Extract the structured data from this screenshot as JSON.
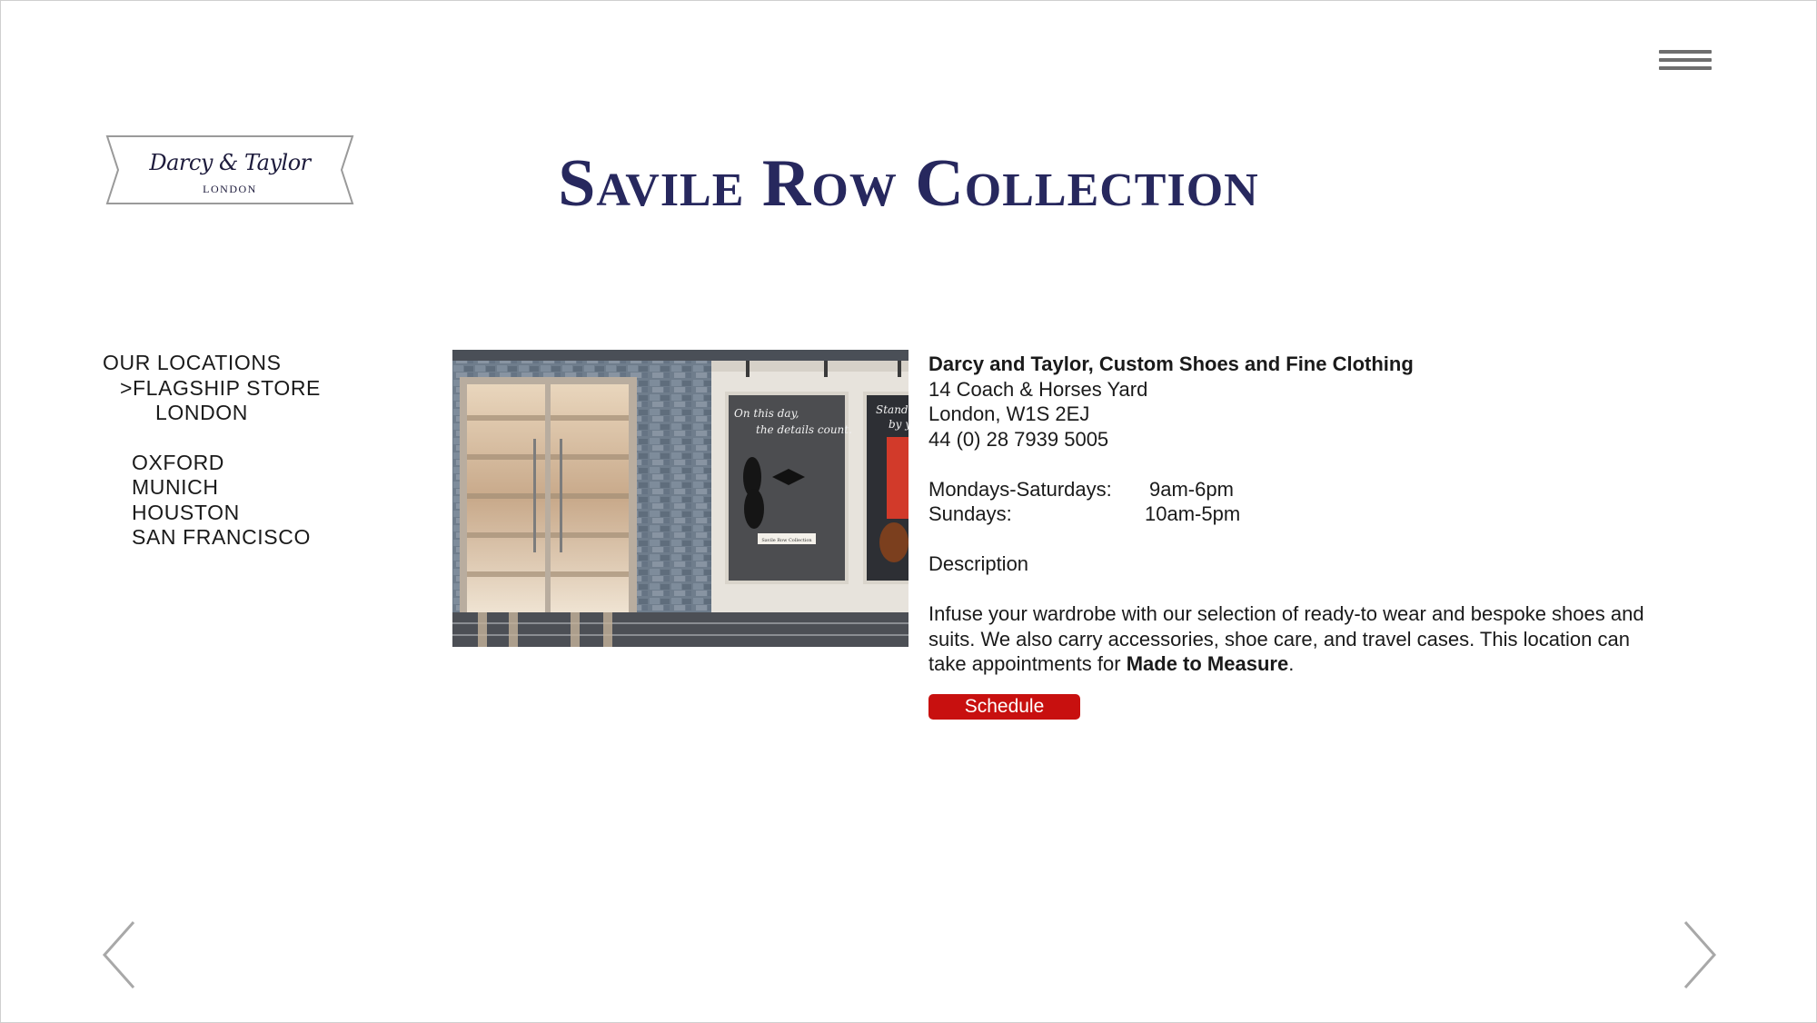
{
  "menu": {
    "icon": "hamburger-menu-icon"
  },
  "logo": {
    "name": "Darcy & Taylor",
    "city": "LONDON"
  },
  "page": {
    "title": "Savile Row Collection"
  },
  "sidebar": {
    "heading": "OUR LOCATIONS",
    "active": ">FLAGSHIP STORE",
    "active_sub": "LONDON",
    "locations": [
      "OXFORD",
      "MUNICH",
      "HOUSTON",
      "SAN FRANCISCO"
    ]
  },
  "store_photo": {
    "poster_left_line1": "On this day,",
    "poster_left_line2": "the details count.",
    "poster_left_tag": "Savile Row Collection",
    "poster_right_line1": "Stand",
    "poster_right_line2": "by y"
  },
  "store": {
    "name": "Darcy and Taylor, Custom Shoes and Fine Clothing",
    "address_line1": "14 Coach & Horses Yard",
    "address_line2": "London, W1S 2EJ",
    "phone": "44 (0) 28 7939 5005",
    "hours": [
      {
        "day": "Mondays-Saturdays:",
        "time": "9am-6pm"
      },
      {
        "day": "Sundays:",
        "time": "10am-5pm"
      }
    ],
    "description_label": "Description",
    "description_text": "Infuse your wardrobe with our selection of ready-to wear and bespoke shoes and suits. We also carry accessories,  shoe care, and travel cases. This location can take appointments for ",
    "description_emphasis": "Made to Measure",
    "description_end": ".",
    "schedule_label": "Schedule"
  },
  "colors": {
    "title": "#27285e",
    "button": "#c8100f"
  },
  "navigation": {
    "prev_icon": "chevron-left-icon",
    "next_icon": "chevron-right-icon"
  }
}
